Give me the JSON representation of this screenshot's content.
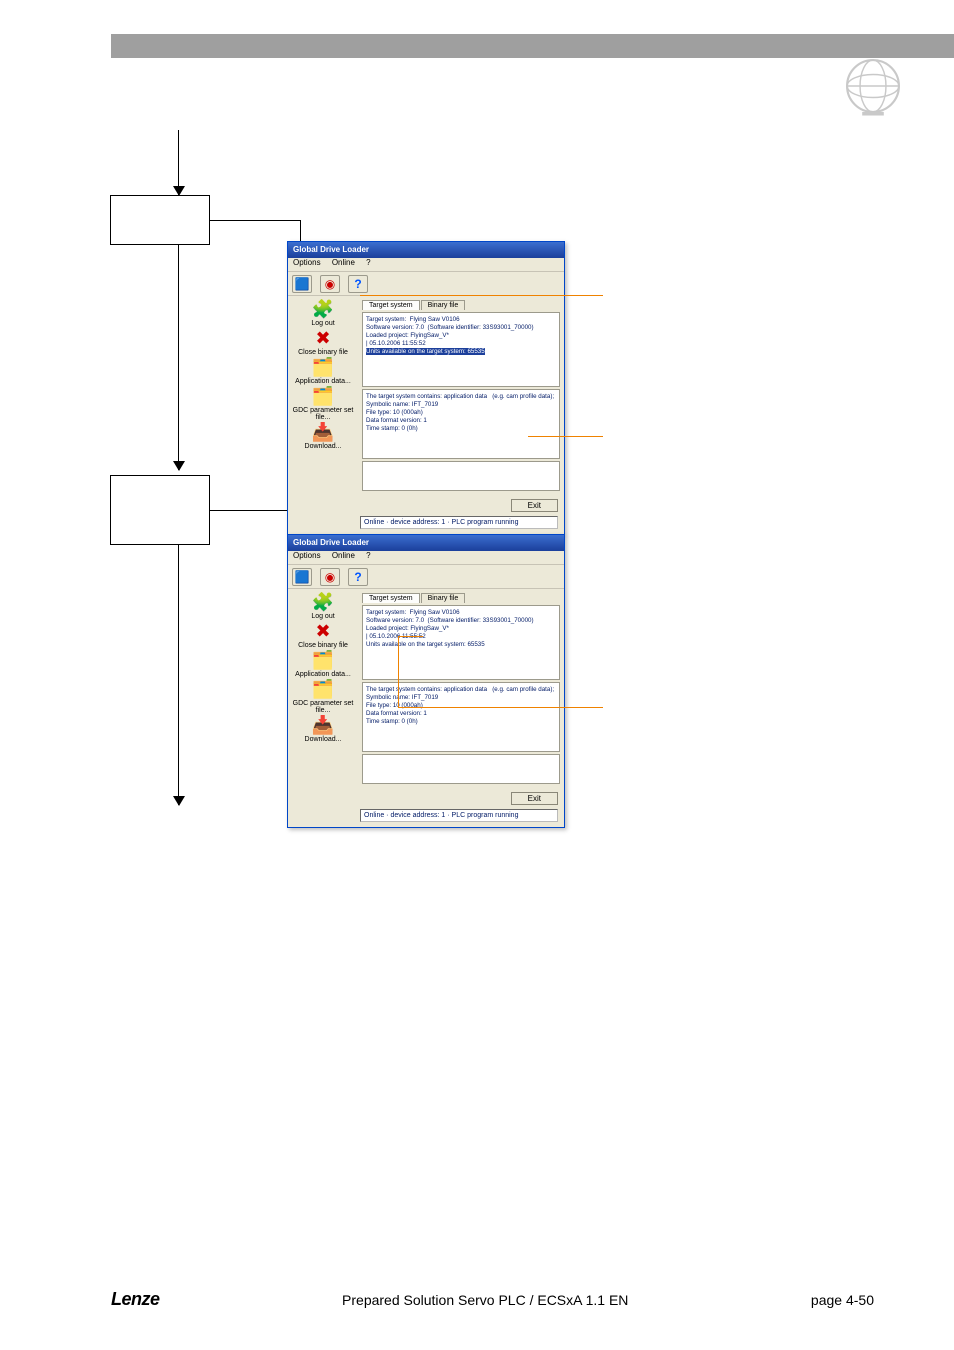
{
  "screenshot_title": "Global Drive Loader",
  "menus": {
    "options": "Options",
    "online": "Online",
    "help": "?"
  },
  "left_panel": {
    "logout": "Log out",
    "close_binary": "Close binary file",
    "app_data": "Application data...",
    "gdc_param": "GDC parameter set file...",
    "download": "Download..."
  },
  "tabs": {
    "target": "Target system",
    "binary": "Binary file"
  },
  "pane_top": "Target system:  Flying Saw V0106\nSoftware version: 7.0  (Software identifier: 33S93001_70000)\nLoaded project: FlyingSaw_V*\n| 05.10.2006 11:55:52",
  "pane_top_tail_hl": "Units available on the target system: 65535",
  "pane_bottom": "The target system contains: application data   (e.g. cam profile data);\nSymbolic name: IFT_7019\nFile type: 10 (000ah)\nData format version: 1\nTime stamp: 0 (0h)",
  "exit_label": "Exit",
  "status_text": "Online · device address: 1 · PLC program running",
  "footer": {
    "center": "Prepared Solution Servo PLC / ECSxA 1.1 EN",
    "right": "page 4-50"
  }
}
